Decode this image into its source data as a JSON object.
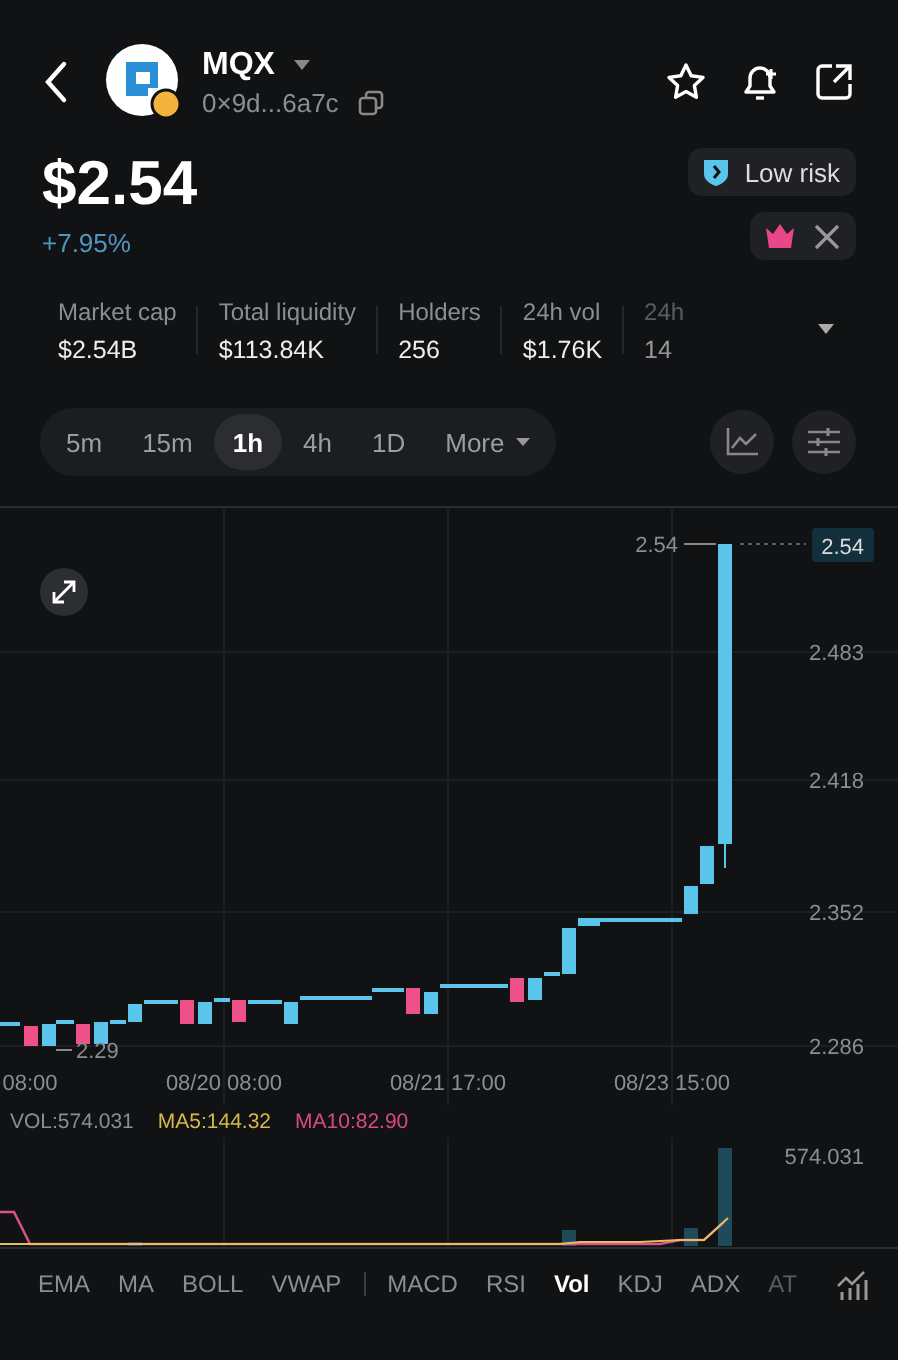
{
  "header": {
    "symbol": "MQX",
    "address": "0×9d...6a7c"
  },
  "price": "$2.54",
  "change": "+7.95%",
  "risk_badge": "Low risk",
  "stats": [
    {
      "label": "Market cap",
      "value": "$2.54B"
    },
    {
      "label": "Total liquidity",
      "value": "$113.84K"
    },
    {
      "label": "Holders",
      "value": "256"
    },
    {
      "label": "24h vol",
      "value": "$1.76K"
    },
    {
      "label": "24h",
      "value": "14",
      "faded": true
    }
  ],
  "timeframes": [
    {
      "label": "5m",
      "selected": false,
      "kind": "plain"
    },
    {
      "label": "15m",
      "selected": false,
      "kind": "plain"
    },
    {
      "label": "1h",
      "selected": true,
      "kind": "plain"
    },
    {
      "label": "4h",
      "selected": false,
      "kind": "plain"
    },
    {
      "label": "1D",
      "selected": false,
      "kind": "plain"
    },
    {
      "label": "More",
      "selected": false,
      "kind": "dropdown"
    }
  ],
  "chart": {
    "price_ticks": [
      "2.483",
      "2.418",
      "2.352",
      "2.286"
    ],
    "current_price": "2.54",
    "high_label": "2.54",
    "low_label": "2.29",
    "time_labels": [
      "08:00",
      "08/20 08:00",
      "08/21 17:00",
      "08/23 15:00"
    ]
  },
  "volume": {
    "vol": "VOL:574.031",
    "ma5": "MA5:144.32",
    "ma10": "MA10:82.90",
    "max_label": "574.031"
  },
  "indicator_groups": [
    [
      {
        "label": "EMA",
        "selected": false
      },
      {
        "label": "MA",
        "selected": false
      },
      {
        "label": "BOLL",
        "selected": false
      },
      {
        "label": "VWAP",
        "selected": false
      }
    ],
    [
      {
        "label": "MACD",
        "selected": false
      },
      {
        "label": "RSI",
        "selected": false
      },
      {
        "label": "Vol",
        "selected": true
      },
      {
        "label": "KDJ",
        "selected": false
      },
      {
        "label": "ADX",
        "selected": false
      },
      {
        "label": "AT",
        "selected": false,
        "faded": true
      }
    ]
  ]
}
